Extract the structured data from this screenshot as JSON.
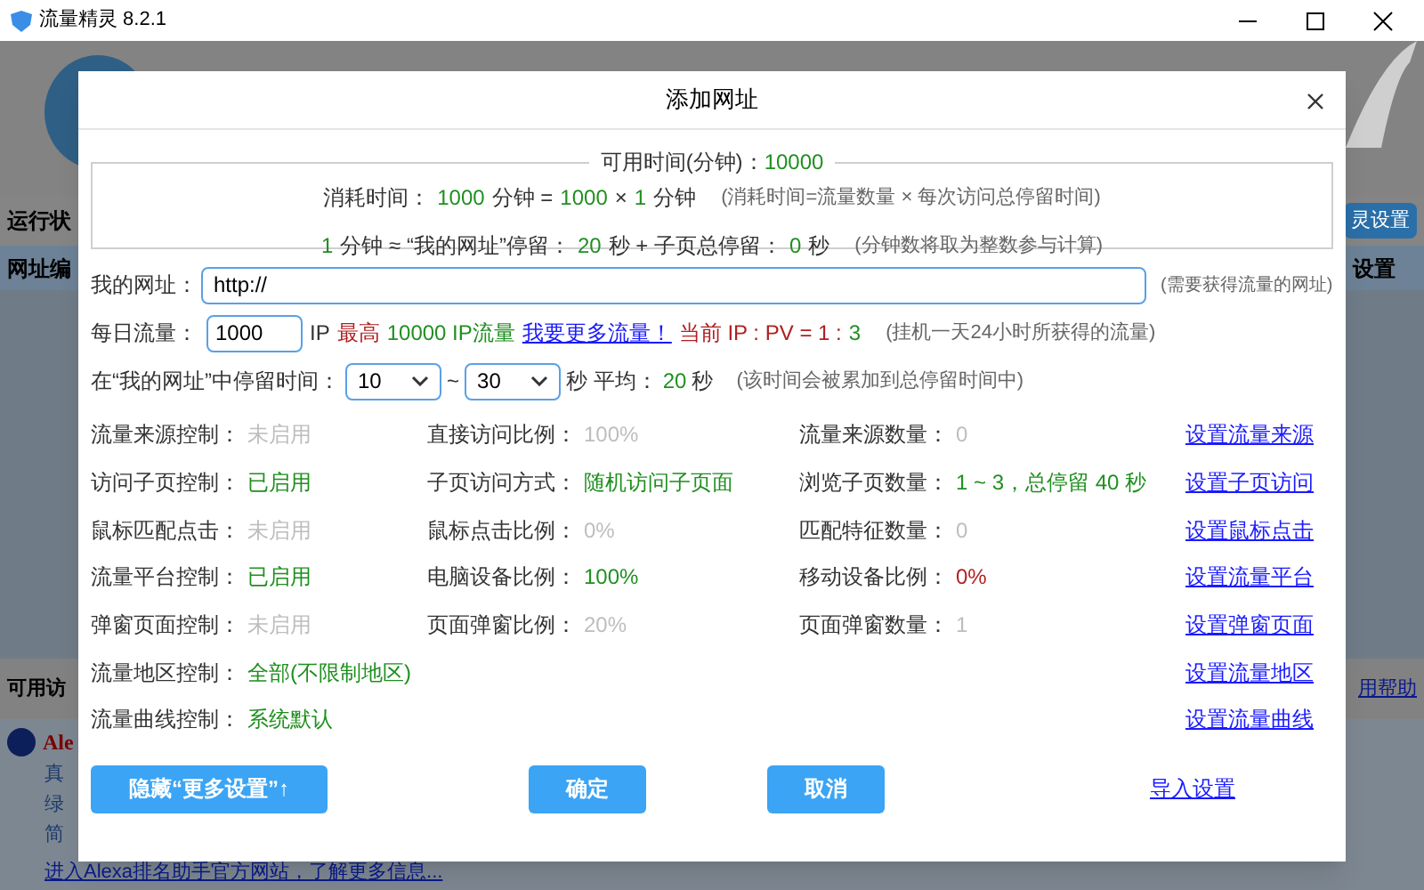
{
  "window": {
    "title": "流量精灵 8.2.1"
  },
  "background": {
    "status_label": "运行状",
    "settings_button": "灵设置",
    "column_1": "网址编",
    "column_2": "设置",
    "available_label": "可用访",
    "help_link": "用帮助",
    "alexa": {
      "title": "Ale",
      "lines": [
        "真",
        "绿",
        "简"
      ],
      "link": "进入Alexa排名助手官方网站，了解更多信息..."
    }
  },
  "dialog": {
    "title": "添加网址",
    "available": {
      "label": "可用时间(分钟)：",
      "value": "10000"
    },
    "summary_lines": [
      [
        {
          "kind": "label",
          "text": "消耗时间："
        },
        {
          "kind": "value",
          "text": "1000"
        },
        {
          "kind": "label",
          "text": "分钟 ="
        },
        {
          "kind": "value",
          "text": "1000"
        },
        {
          "kind": "label",
          "text": "×"
        },
        {
          "kind": "value",
          "text": "1"
        },
        {
          "kind": "label",
          "text": "分钟"
        },
        {
          "kind": "note",
          "text": "(消耗时间=流量数量 × 每次访问总停留时间)"
        }
      ],
      [
        {
          "kind": "value",
          "text": "1"
        },
        {
          "kind": "label",
          "text": "分钟 ≈ “我的网址”停留："
        },
        {
          "kind": "value",
          "text": "20"
        },
        {
          "kind": "label",
          "text": "秒 + 子页总停留："
        },
        {
          "kind": "value",
          "text": "0"
        },
        {
          "kind": "label",
          "text": "秒"
        },
        {
          "kind": "note",
          "text": "(分钟数将取为整数参与计算)"
        }
      ]
    ],
    "url": {
      "label": "我的网址：",
      "value": "http://",
      "hint": "(需要获得流量的网址)"
    },
    "daily": {
      "label": "每日流量：",
      "value": "1000",
      "parts": [
        {
          "kind": "label",
          "text": "IP"
        },
        {
          "kind": "red",
          "text": "最高"
        },
        {
          "kind": "value",
          "text": "10000 IP流量"
        },
        {
          "kind": "link",
          "text": "我要更多流量！"
        },
        {
          "kind": "red",
          "text": "当前 IP : PV = 1 :"
        },
        {
          "kind": "value",
          "text": "3"
        },
        {
          "kind": "note",
          "text": "(挂机一天24小时所获得的流量)"
        }
      ]
    },
    "dwell": {
      "label": "在“我的网址”中停留时间：",
      "min": "10",
      "separator": "~",
      "max": "30",
      "parts": [
        {
          "kind": "label",
          "text": "秒 平均："
        },
        {
          "kind": "value",
          "text": "20"
        },
        {
          "kind": "label",
          "text": "秒"
        },
        {
          "kind": "note",
          "text": "(该时间会被累加到总停留时间中)"
        }
      ]
    },
    "settings": [
      {
        "cells": [
          {
            "label": "流量来源控制：",
            "value": "未启用",
            "kind": "off"
          },
          {
            "label": "直接访问比例：",
            "value": "100%",
            "kind": "off"
          },
          {
            "label": "流量来源数量：",
            "value": "0",
            "kind": "off"
          }
        ],
        "link": "设置流量来源"
      },
      {
        "cells": [
          {
            "label": "访问子页控制：",
            "value": "已启用",
            "kind": "on"
          },
          {
            "label": "子页访问方式：",
            "value": "随机访问子页面",
            "kind": "on"
          },
          {
            "label": "浏览子页数量：",
            "value": "1 ~ 3，总停留 40 秒",
            "kind": "on"
          }
        ],
        "link": "设置子页访问"
      },
      {
        "cells": [
          {
            "label": "鼠标匹配点击：",
            "value": "未启用",
            "kind": "off"
          },
          {
            "label": "鼠标点击比例：",
            "value": "0%",
            "kind": "off"
          },
          {
            "label": "匹配特征数量：",
            "value": "0",
            "kind": "off"
          }
        ],
        "link": "设置鼠标点击"
      },
      {
        "cells": [
          {
            "label": "流量平台控制：",
            "value": "已启用",
            "kind": "on"
          },
          {
            "label": "电脑设备比例：",
            "value": "100%",
            "kind": "on"
          },
          {
            "label": "移动设备比例：",
            "value": "0%",
            "kind": "warn"
          }
        ],
        "link": "设置流量平台"
      },
      {
        "cells": [
          {
            "label": "弹窗页面控制：",
            "value": "未启用",
            "kind": "off"
          },
          {
            "label": "页面弹窗比例：",
            "value": "20%",
            "kind": "off"
          },
          {
            "label": "页面弹窗数量：",
            "value": "1",
            "kind": "off"
          }
        ],
        "link": "设置弹窗页面"
      },
      {
        "cells": [
          {
            "label": "流量地区控制：",
            "value": "全部(不限制地区)",
            "kind": "on"
          }
        ],
        "link": "设置流量地区"
      },
      {
        "cells": [
          {
            "label": "流量曲线控制：",
            "value": "系统默认",
            "kind": "on"
          }
        ],
        "link": "设置流量曲线"
      }
    ],
    "buttons": {
      "toggle": "隐藏“更多设置”↑",
      "ok": "确定",
      "cancel": "取消",
      "import_link": "导入设置"
    }
  }
}
